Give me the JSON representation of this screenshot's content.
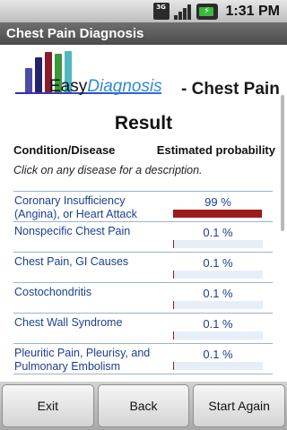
{
  "status_bar": {
    "network_label": "3G",
    "time": "1:31 PM",
    "battery_label": "⚡"
  },
  "app": {
    "title": "Chest Pain Diagnosis"
  },
  "header": {
    "logo_text_1": "Easy",
    "logo_text_2": "Diagnosis",
    "title": "- Chest Pain"
  },
  "result": {
    "heading": "Result",
    "col_condition": "Condition/Disease",
    "col_probability": "Estimated probability",
    "hint": "Click on any disease for a description.",
    "rows": [
      {
        "name": "Coronary Insufficiency (Angina), or Heart Attack",
        "pct": "99 %",
        "value": 99
      },
      {
        "name": "Nonspecific Chest Pain",
        "pct": "0.1 %",
        "value": 0.1
      },
      {
        "name": "Chest Pain, GI Causes",
        "pct": "0.1 %",
        "value": 0.1
      },
      {
        "name": "Costochondritis",
        "pct": "0.1 %",
        "value": 0.1
      },
      {
        "name": "Chest Wall Syndrome",
        "pct": "0.1 %",
        "value": 0.1
      },
      {
        "name": "Pleuritic Pain, Pleurisy, and Pulmonary Embolism",
        "pct": "0.1 %",
        "value": 0.1
      }
    ]
  },
  "buttons": {
    "exit": "Exit",
    "back": "Back",
    "start_again": "Start Again"
  },
  "colors": {
    "link_text": "#1b3f93",
    "bar_fill": "#9b1b1b",
    "bar_track": "#e6eef8"
  }
}
